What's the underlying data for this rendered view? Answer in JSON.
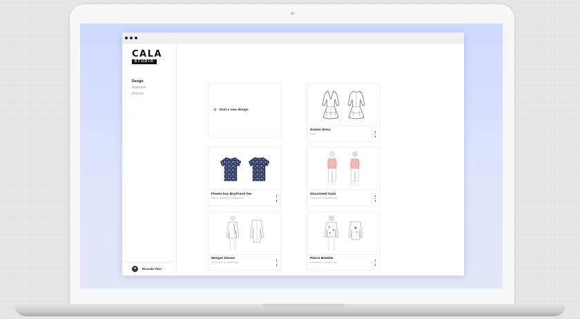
{
  "sidebar": {
    "logo": {
      "main": "CALA",
      "sub": "STUDIO"
    },
    "nav": [
      {
        "label": "Design",
        "active": true
      },
      {
        "label": "Materials",
        "active": false
      },
      {
        "label": "Artwork",
        "active": false
      }
    ],
    "user": {
      "name": "Ricardo Tisci"
    }
  },
  "main": {
    "new_design_label": "Start a new design",
    "cards": [
      {
        "title": "Sammi dress",
        "subtitle": "Draft",
        "art": "sketch-dress"
      },
      {
        "title": "Flower boy Boyfriend Tee",
        "subtitle": "Status: Awaiting PO Approval",
        "art": "floral-tee"
      },
      {
        "title": "Structured Cami",
        "subtitle": "Launched: 2 months ago",
        "art": "cami"
      },
      {
        "title": "Morgan blouse",
        "subtitle": "Launched: 3 months ago",
        "art": "blouse"
      },
      {
        "title": "Pierce Bomber",
        "subtitle": "Launched: 3 months ago",
        "art": "bomber"
      }
    ]
  },
  "colors": {
    "screen_bg": "#cdd9ff",
    "floral_navy": "#26365e",
    "cami_pink": "#f2b7b7"
  },
  "icons": {
    "new": "plus-icon",
    "menu": "kebab-icon",
    "window": "traffic-dots-icon"
  }
}
